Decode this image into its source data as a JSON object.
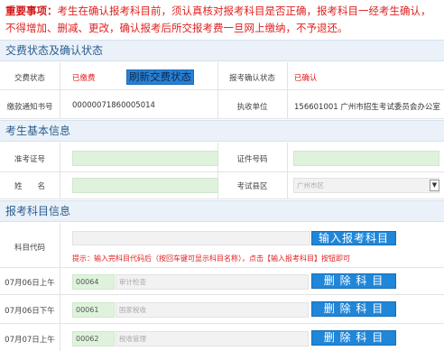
{
  "notice": {
    "lead": "重要事项：",
    "line1": "考生在确认报考科目前，须认真核对报考科目是否正确，报考科目一经考生确认，",
    "line2": "不得增加、删减、更改，确认报考后所交报考费一旦网上缴纳，不予退还。"
  },
  "sections": {
    "payment": "交费状态及确认状态",
    "basic": "考生基本信息",
    "subjects": "报考科目信息"
  },
  "payment": {
    "fee_status_label": "交费状态",
    "fee_status_value": "已缴费",
    "refresh_button": "刷新交费状态",
    "confirm_status_label": "报考确认状态",
    "confirm_status_value": "已确认",
    "notice_no_label": "缴款通知书号",
    "notice_no_value": "0000007186000501​4",
    "unit_label": "执收单位",
    "unit_value": "156601001 广州市招生考试委员会办公室"
  },
  "basic": {
    "admission_label": "准考证号",
    "id_label": "证件号码",
    "name_label": "姓　　名",
    "district_label": "考试县区",
    "district_value": "广州市区"
  },
  "subjects": {
    "code_label": "科目代码",
    "input_button": "输入报考科目",
    "hint": "提示：输入完科目代码后（按回车键可显示科目名称），点击【输入报考科目】按钮即可",
    "rows": [
      {
        "time": "07月06日上午",
        "code": "00064",
        "name": "审计检查",
        "delete_button": "删 除 科 目"
      },
      {
        "time": "07月06日下午",
        "code": "00061",
        "name": "国家税收",
        "delete_button": "删 除 科 目"
      },
      {
        "time": "07月07日上午",
        "code": "00062",
        "name": "税收管理",
        "delete_button": "删 除 科 目"
      }
    ]
  }
}
